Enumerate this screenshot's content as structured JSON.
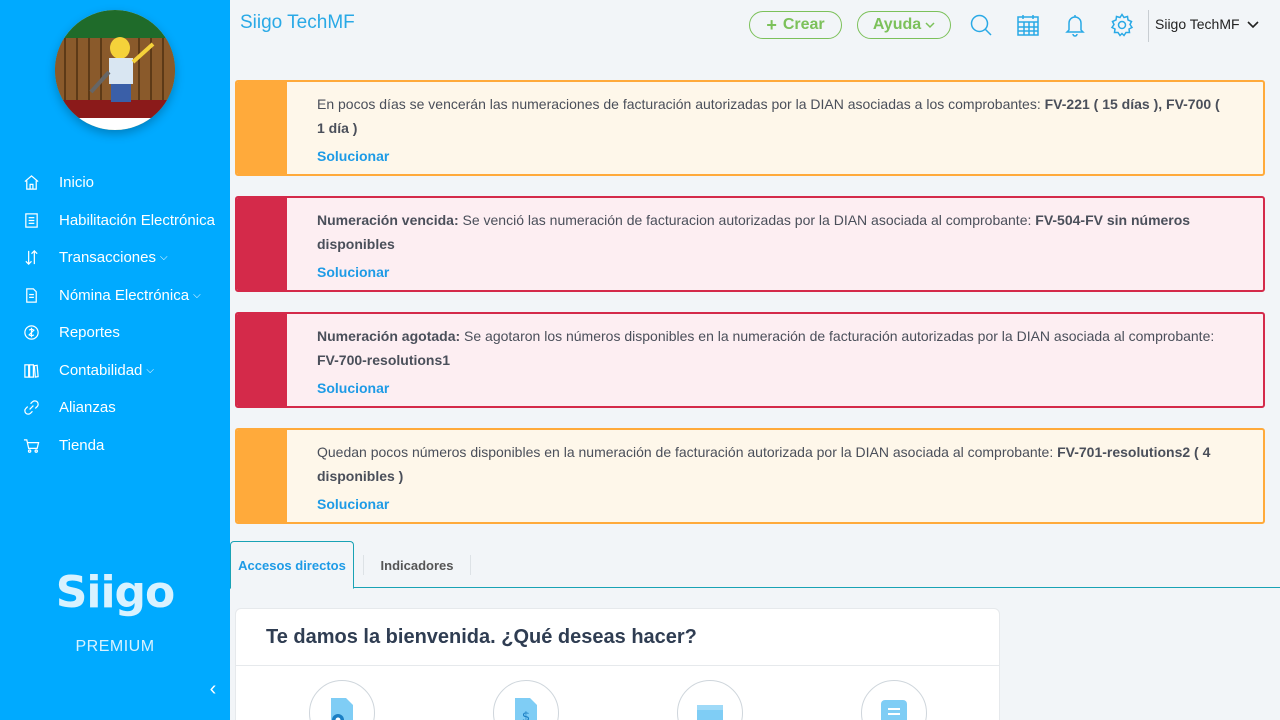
{
  "header": {
    "company": "Siigo TechMF",
    "create_label": "Crear",
    "help_label": "Ayuda",
    "user_label": "Siigo TechMF"
  },
  "sidebar": {
    "items": [
      {
        "label": "Inicio",
        "icon": "home-icon"
      },
      {
        "label": "Habilitación Electrónica",
        "icon": "receipt-icon"
      },
      {
        "label": "Transacciones",
        "icon": "transactions-icon",
        "expandable": true
      },
      {
        "label": "Nómina Electrónica",
        "icon": "document-icon",
        "expandable": true
      },
      {
        "label": "Reportes",
        "icon": "globe-icon"
      },
      {
        "label": "Contabilidad",
        "icon": "books-icon",
        "expandable": true
      },
      {
        "label": "Alianzas",
        "icon": "link-icon"
      },
      {
        "label": "Tienda",
        "icon": "cart-icon"
      }
    ],
    "brand": "Siigo",
    "brand_sub": "PREMIUM"
  },
  "alerts": [
    {
      "type": "warning",
      "text": "En pocos días se vencerán las numeraciones de facturación autorizadas por la DIAN asociadas a los comprobantes: ",
      "strong": "FV-221 ( 15 días ), FV-700 ( 1 día )",
      "action": "Solucionar"
    },
    {
      "type": "danger",
      "lead": "Numeración vencida:",
      "text": " Se venció las numeración de facturacion autorizadas por la DIAN asociada al comprobante: ",
      "strong": "FV-504-FV sin números disponibles",
      "action": "Solucionar"
    },
    {
      "type": "danger",
      "lead": "Numeración agotada:",
      "text": " Se agotaron los números disponibles en la numeración de facturación autorizadas por la DIAN asociada al comprobante: ",
      "strong": "FV-700-resolutions1",
      "action": "Solucionar"
    },
    {
      "type": "warning",
      "text": "Quedan pocos números disponibles en la numeración de facturación autorizada por la DIAN asociada al comprobante: ",
      "strong": "FV-701-resolutions2 ( 4 disponibles )",
      "action": "Solucionar"
    }
  ],
  "tabs": [
    {
      "label": "Accesos directos",
      "active": true
    },
    {
      "label": "Indicadores",
      "active": false
    }
  ],
  "welcome": {
    "title": "Te damos la bienvenida. ¿Qué deseas hacer?"
  },
  "colors": {
    "sidebar": "#00aaff",
    "accent": "#29a9e6",
    "green": "#7cc15a",
    "warning": "#ffaa3b",
    "danger": "#d42a4a"
  }
}
